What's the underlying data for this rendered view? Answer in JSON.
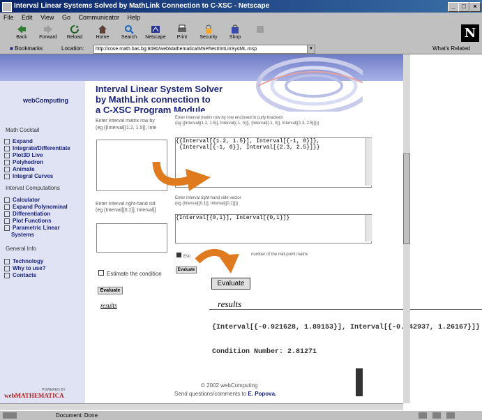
{
  "window": {
    "title": "Interval Linear Systems Solved by MathLink Connection to C-XSC - Netscape",
    "controls": [
      "_",
      "□",
      "×"
    ]
  },
  "menu": [
    "File",
    "Edit",
    "View",
    "Go",
    "Communicator",
    "Help"
  ],
  "toolbar": {
    "buttons": [
      "Back",
      "Forward",
      "Reload",
      "Home",
      "Search",
      "Netscape",
      "Print",
      "Security",
      "Shop"
    ],
    "logo": "N"
  },
  "location": {
    "bookmarks_label": "Bookmarks",
    "location_label": "Location:",
    "url": "http://cose.math.bas.bg:8080/webMathematica/MSP/test/IntLinSysML.msp",
    "whats_related": "What's Related"
  },
  "sidebar": {
    "brand": "webComputing",
    "sections": [
      {
        "title": "Math Cocktail",
        "items": [
          "Expand",
          "Integrate/Differentiate",
          "Plot3D Live",
          "Polyhedron",
          "Animate",
          "Integral Curves"
        ]
      },
      {
        "title": "Interval Computations",
        "items": [
          "Calculator",
          "Expand Polynominal",
          "Differentiation",
          "Plot Functions",
          "Parametric Linear",
          "Systems"
        ]
      },
      {
        "title": "General Info",
        "items": [
          "Technology",
          "Why to use?",
          "Contacts"
        ]
      }
    ],
    "footer_powered": "POWERED BY",
    "footer_logo": "webMATHEMATICA"
  },
  "main": {
    "title_lines": [
      "Interval Linear System Solver",
      "by MathLink connection to",
      "a C-XSC Program Module"
    ],
    "back_matrix_label": "Enter interval matrix row by",
    "back_matrix_eg": "(eg {{Interval[{1.2, 1.5}], Inte",
    "back_rhs_label": "Enter interval right-hand sid",
    "back_rhs_eg": "(eg {Interval[{0,1}], Interval[{",
    "back_estimate": "Estimate the condition",
    "back_evaluate": "Evaluate",
    "back_results": "results",
    "matrix_label": "Enter interval matrix row by row enclosed in curly brackets",
    "matrix_eg": "(eg {{Interval[{1.2, 1.5}], Interval[{-1, 0}]}, {Interval[{-1, 0}], Interval[{2.3, 2.5}]}})",
    "matrix_value": "{{Interval[{1.2, 1.5}], Interval[{-1, 0}]},\n {Interval[{-1, 0}], Interval[{2.3, 2.5}]}}",
    "rhs_label": "Enter interval right-hand side vector",
    "rhs_eg": "(eg {Interval[{0,1}], Interval[{0,1}]})",
    "rhs_value": "{Interval[{0,1}], Interval[{0,1}]}",
    "estimate_label_start": "Esti",
    "estimate_label_end": "number of the mid-point matrix",
    "evaluate_small": "Evaluate",
    "evaluate_big": "Evaluate",
    "results_label": "results",
    "result_vector": "{Interval[{-0.921628, 1.89153}], Interval[{-0.642937, 1.26167}]}",
    "condition_number": "Condition Number: 2.81271",
    "copyright": "© 2002 webComputing",
    "send_questions": "Send questions/comments to",
    "author": "E. Popova."
  },
  "status": {
    "text": "Document: Done"
  },
  "colors": {
    "title_blue": "#1a237e",
    "arrow_orange": "#e07a1f",
    "banner": "#7f8bd0"
  }
}
